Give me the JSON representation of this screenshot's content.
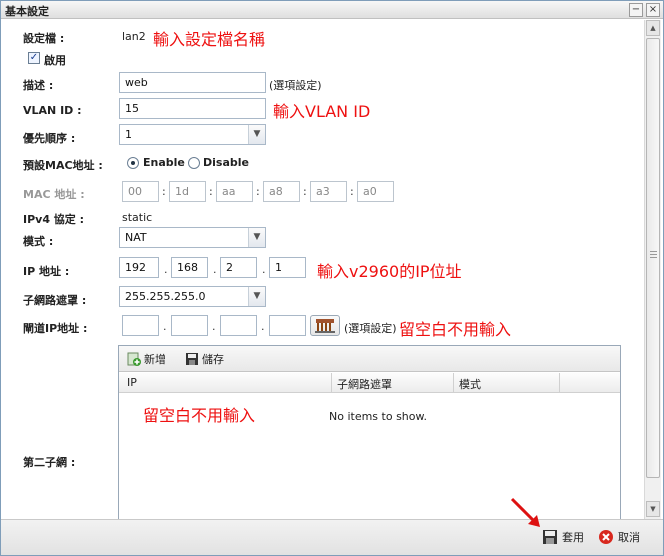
{
  "window": {
    "title": "基本設定",
    "minimize_glyph": "−",
    "close_glyph": "×"
  },
  "form": {
    "config_file": {
      "label": "設定檔 :",
      "value": "lan2",
      "annotation": "輸入設定檔名稱"
    },
    "enable_checkbox": {
      "label": "啟用",
      "checked": true
    },
    "description": {
      "label": "描述 :",
      "value": "web",
      "hint": "(選項設定)"
    },
    "vlan_id": {
      "label": "VLAN ID :",
      "value": "15",
      "annotation": "輸入VLAN ID"
    },
    "priority": {
      "label": "優先順序 :",
      "selected": "1"
    },
    "default_mac": {
      "label": "預設MAC地址 :",
      "options": [
        "Enable",
        "Disable"
      ],
      "selected": "Enable"
    },
    "mac_address": {
      "label": "MAC 地址 :",
      "octets": [
        "00",
        "1d",
        "aa",
        "a8",
        "a3",
        "a0"
      ],
      "separator": ":"
    },
    "ipv4_protocol": {
      "label": "IPv4 協定 :",
      "value": "static"
    },
    "mode": {
      "label": "模式 :",
      "selected": "NAT"
    },
    "ip_address": {
      "label": "IP 地址 :",
      "octets": [
        "192",
        "168",
        "2",
        "1"
      ],
      "separator": ".",
      "annotation": "輸入v2960的IP位址"
    },
    "subnet_mask": {
      "label": "子網路遮罩 :",
      "selected": "255.255.255.0"
    },
    "gateway_ip": {
      "label": "閘道IP地址 :",
      "octets": [
        "",
        "",
        "",
        ""
      ],
      "separator": ".",
      "hint": "(選項設定)",
      "annotation": "留空白不用輸入"
    },
    "second_subnet": {
      "label": "第二子網 :",
      "toolbar": {
        "add_label": "新增",
        "save_label": "儲存"
      },
      "columns": [
        "IP",
        "子網路遮罩",
        "模式"
      ],
      "empty_text": "No items to show.",
      "annotation": "留空白不用輸入"
    }
  },
  "footer": {
    "apply_label": "套用",
    "cancel_label": "取消"
  },
  "colors": {
    "annotation": "#ee1111",
    "arrow": "#d11"
  }
}
